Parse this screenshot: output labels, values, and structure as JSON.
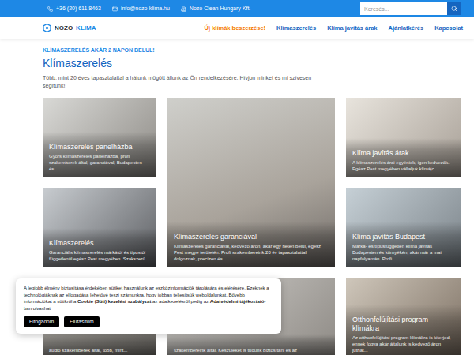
{
  "topbar": {
    "phone": "+36 (20) 611 8463",
    "email": "info@nozo-klima.hu",
    "company": "Nozo Clean Hungary Kft.",
    "search_placeholder": "Keresés..."
  },
  "nav": {
    "logo": [
      "NOZO",
      "KLIMA"
    ],
    "items": [
      {
        "label": "Új klímák beszerzése!",
        "selected": true
      },
      {
        "label": "Klímaszerelés",
        "selected": false
      },
      {
        "label": "Klíma javítás árak",
        "selected": false
      },
      {
        "label": "Ajánlatkérés",
        "selected": false
      },
      {
        "label": "Kapcsolat",
        "selected": false
      }
    ]
  },
  "hero": {
    "kicker": "KLÍMASZERELÉS AKÁR 2 NAPON BELÜL!",
    "title": "Klímaszerelés",
    "intro": "Több, mint 20 éves tapasztalattal a hátunk mögött állunk az Ön rendelkezésére. Hívjon minket és mi szívesen segítünk!"
  },
  "cards": [
    {
      "title": "Klímaszerelés panelházba",
      "description": "Gyors klímaszerelés panelházba, profi szakemberek által, garanciával, Budapesten és..."
    },
    {
      "title": "Klímaszerelés garanciával",
      "description": "Klímaszerelés garanciával, kedvező áron, akár egy héten belül, egész Pest megye területén. Profi szakembereink 20 év tapasztalattal dolgoznak, precízen és..."
    },
    {
      "title": "Klíma javítás árak",
      "description": "A klímaszerelés árai egyéniek, igen kedvezők. Egész Pest megyében vállaljuk klímájc..."
    },
    {
      "title": "Klímaszerelés",
      "description": "Garanciális klímaszerelés márkától és típustól függetlenül egész Pest megyében. Szakszerű..."
    },
    {
      "title": "Klíma javítás Budapest",
      "description": "Márka- és típusfüggetlen klíma javítás Budapesten és környékén, akár már a mai napfolyamán. Profi..."
    },
    {
      "description": "audió szakemberek által, több, mint..."
    },
    {
      "description": "szakembereink által. Készüléket is tudunk biztosítani és az"
    },
    {
      "title": "Otthonfelújítási program klímákra",
      "description": "Az otthonfelújítási program klímákra is kiterjed, ennek fogva akár általunk is kedvező áron juthat..."
    }
  ],
  "cookie": {
    "text": [
      {
        "text": "A legjobb élmény biztosítása érdekében sütiket használunk az eszközinformációk tárolására és elérésére. Ezeknek a technológiáknak az elfogadása lehetővé teszi számunkra, hogy jobban teljesítsük weboldalunkat. Bővebb információkat a sütikről a ",
        "bold": false
      },
      {
        "text": "Cookie (Süti) kezelési szabályzat",
        "bold": true
      },
      {
        "text": " az adatkezelésről pedig az ",
        "bold": false
      },
      {
        "text": "Adatvédelmi tájékoztató",
        "bold": true
      },
      {
        "text": "-ban olvashat",
        "bold": false
      }
    ],
    "buttons": [
      "Elfogadom",
      "Elutasítom"
    ]
  }
}
